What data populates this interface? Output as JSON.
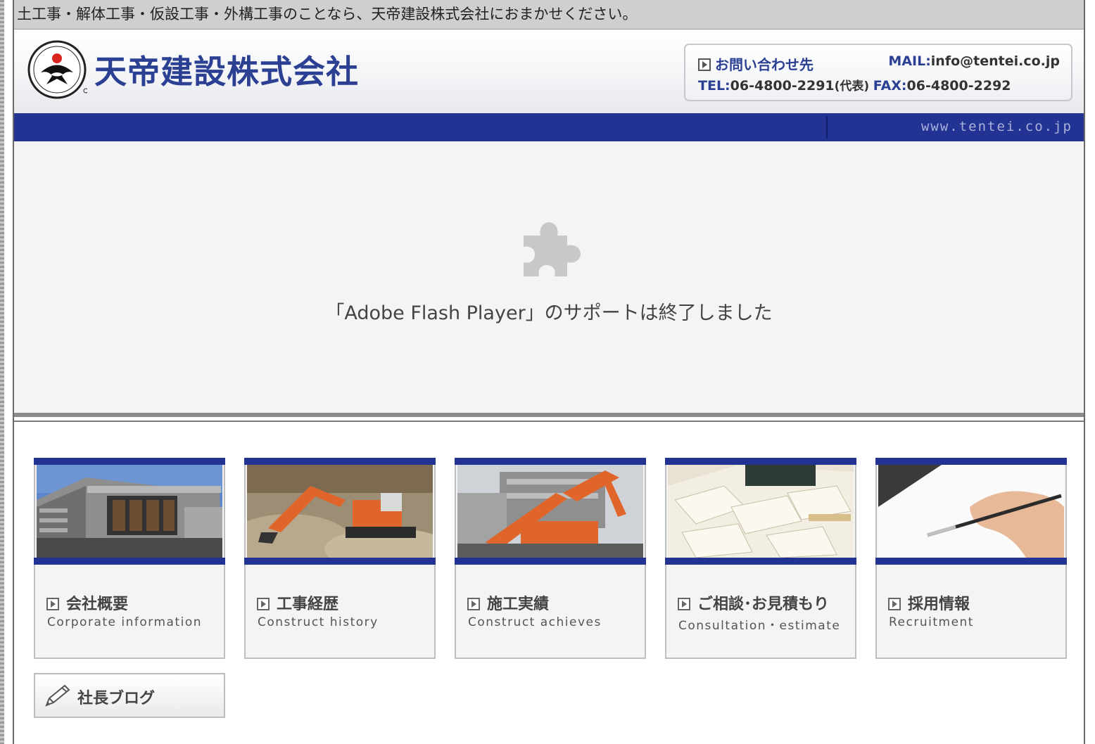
{
  "banner_text": "土工事・解体工事・仮設工事・外構工事のことなら、天帝建設株式会社におまかせください。",
  "header": {
    "company_name": "天帝建設株式会社",
    "contact_title": "お問い合わせ先",
    "mail_label": "MAIL:",
    "mail_value": "info@tentei.co.jp",
    "tel_label": "TEL:",
    "tel_value": "06-4800-2291",
    "tel_note": "(代表)",
    "fax_label": "FAX:",
    "fax_value": "06-4800-2292"
  },
  "navband": {
    "url": "www.tentei.co.jp"
  },
  "flash": {
    "message": "「Adobe Flash Player」のサポートは終了しました"
  },
  "cards": [
    {
      "title": "会社概要",
      "subtitle": "Corporate information"
    },
    {
      "title": "工事経歴",
      "subtitle": "Construct history"
    },
    {
      "title": "施工実績",
      "subtitle": "Construct achieves"
    },
    {
      "title": "ご相談･お見積もり",
      "subtitle": "Consultation・estimate"
    },
    {
      "title": "採用情報",
      "subtitle": "Recruitment"
    }
  ],
  "blog": {
    "label": "社長ブログ"
  },
  "colors": {
    "brand_navy": "#233394",
    "brand_blue_text": "#2b3f93",
    "panel_gray": "#f4f4f4"
  }
}
